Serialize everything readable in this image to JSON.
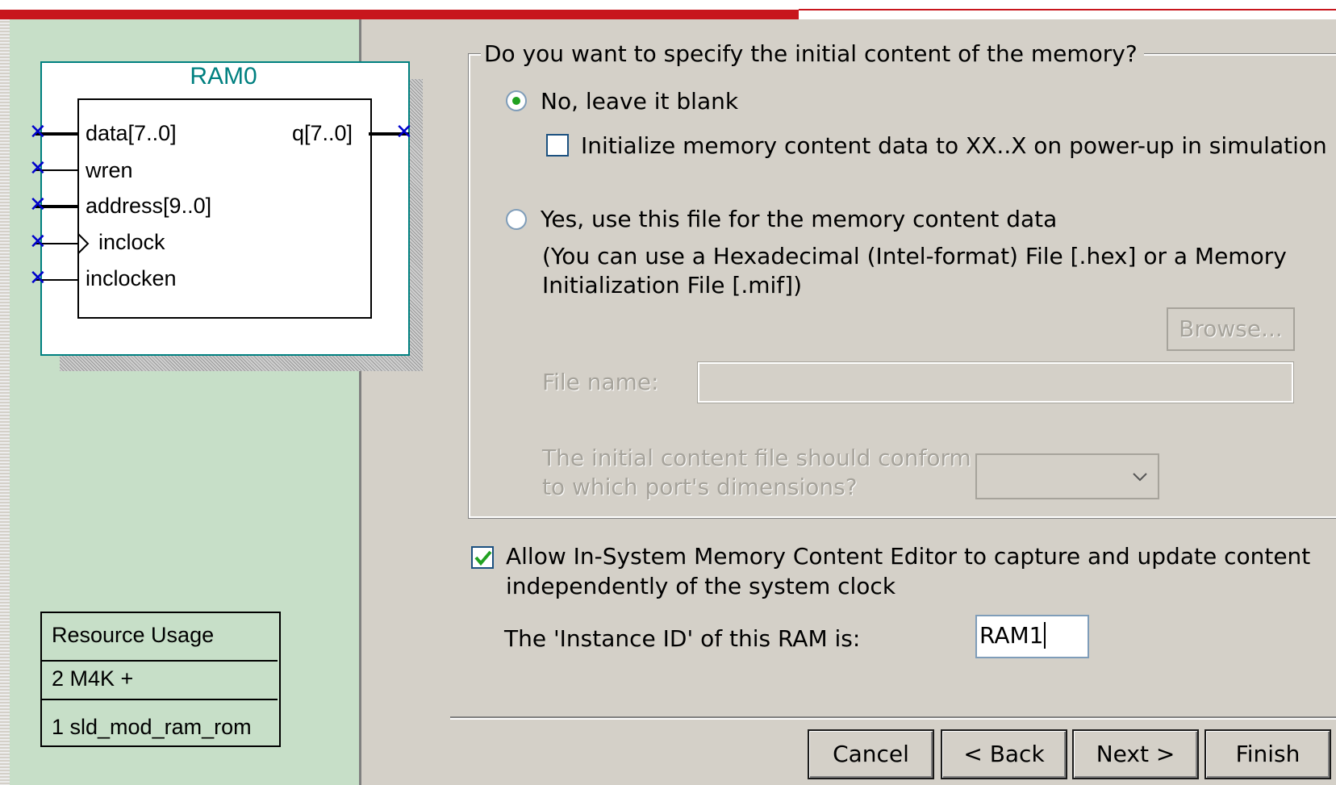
{
  "symbol": {
    "title": "RAM0",
    "inputs": [
      "data[7..0]",
      "wren",
      "address[9..0]",
      "inclock",
      "inclocken"
    ],
    "output": "q[7..0]"
  },
  "resource_usage": {
    "header": "Resource Usage",
    "rows": [
      "2 M4K +",
      "1 sld_mod_ram_rom"
    ]
  },
  "init_group": {
    "legend": "Do you want to specify the initial content of the memory?",
    "option_no": "No, leave it blank",
    "option_no_selected": true,
    "init_xx_label": "Initialize memory content data to XX..X on power-up in simulation",
    "init_xx_checked": false,
    "option_yes": "Yes, use this file for the memory content data",
    "option_yes_selected": false,
    "hint_line1": "(You can use a Hexadecimal (Intel-format) File [.hex] or a Memory",
    "hint_line2": "Initialization File [.mif])",
    "browse_label": "Browse...",
    "file_name_label": "File name:",
    "file_name_value": "",
    "conform_line1": "The initial content file should conform",
    "conform_line2": "to which port's dimensions?",
    "conform_value": ""
  },
  "isme": {
    "checked": true,
    "label_line1": "Allow In-System Memory Content Editor to capture and update content",
    "label_line2": "independently of the system clock",
    "instance_label": "The 'Instance ID' of this RAM is:",
    "instance_value": "RAM1"
  },
  "buttons": {
    "cancel": "Cancel",
    "back": "< Back",
    "next": "Next >",
    "finish": "Finish"
  },
  "colors": {
    "progress": "#c8161d",
    "symbol_accent": "#008080",
    "panel_bg": "#c7dfc8",
    "dialog_bg": "#d4d0c8"
  }
}
